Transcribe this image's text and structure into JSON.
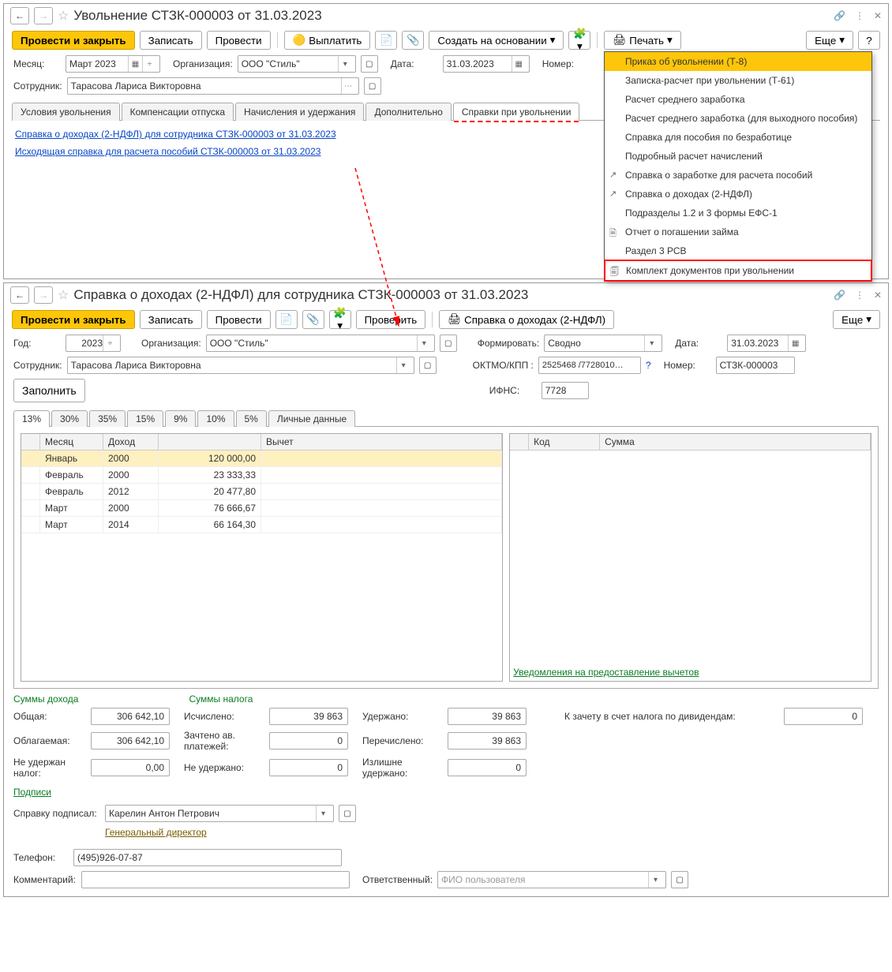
{
  "win1": {
    "title": "Увольнение СТЗК-000003 от 31.03.2023",
    "toolbar": {
      "post_close": "Провести и закрыть",
      "save": "Записать",
      "post": "Провести",
      "pay": "Выплатить",
      "create_based": "Создать на основании",
      "print": "Печать",
      "more": "Еще",
      "help": "?"
    },
    "fields": {
      "month_lbl": "Месяц:",
      "month": "Март 2023",
      "org_lbl": "Организация:",
      "org": "ООО \"Стиль\"",
      "date_lbl": "Дата:",
      "date": "31.03.2023",
      "num_lbl": "Номер:",
      "emp_lbl": "Сотрудник:",
      "emp": "Тарасова Лариса Викторовна"
    },
    "tabs": [
      "Условия увольнения",
      "Компенсации отпуска",
      "Начисления и удержания",
      "Дополнительно",
      "Справки при увольнении"
    ],
    "links": [
      "Справка о доходах (2-НДФЛ) для сотрудника СТЗК-000003 от 31.03.2023",
      "Исходящая справка для расчета пособий СТЗК-000003 от 31.03.2023"
    ],
    "menu": [
      {
        "t": "Приказ об увольнении (Т-8)",
        "hl": true
      },
      {
        "t": "Записка-расчет при увольнении (Т-61)"
      },
      {
        "t": "Расчет среднего заработка"
      },
      {
        "t": "Расчет среднего заработка (для выходного пособия)"
      },
      {
        "t": "Справка для пособия по безработице"
      },
      {
        "t": "Подробный расчет начислений"
      },
      {
        "t": "Справка о заработке для расчета пособий",
        "icon": "↗"
      },
      {
        "t": "Справка о доходах (2-НДФЛ)",
        "icon": "↗"
      },
      {
        "t": "Подразделы 1.2 и 3 формы ЕФС-1"
      },
      {
        "t": "Отчет о погашении займа",
        "icon": "🗎"
      },
      {
        "t": "Раздел 3 РСВ"
      },
      {
        "t": "Комплект документов при увольнении",
        "icon": "🗐",
        "boxed": true
      }
    ]
  },
  "win2": {
    "title": "Справка о доходах (2-НДФЛ) для сотрудника СТЗК-000003 от 31.03.2023",
    "toolbar": {
      "post_close": "Провести и закрыть",
      "save": "Записать",
      "post": "Провести",
      "check": "Проверить",
      "print_ref": "Справка о доходах (2-НДФЛ)",
      "more": "Еще"
    },
    "fields": {
      "year_lbl": "Год:",
      "year": "2023",
      "org_lbl": "Организация:",
      "org": "ООО \"Стиль\"",
      "form_lbl": "Формировать:",
      "form": "Сводно",
      "date_lbl": "Дата:",
      "date": "31.03.2023",
      "emp_lbl": "Сотрудник:",
      "emp": "Тарасова Лариса Викторовна",
      "oktmo_lbl": "ОКТМО/КПП :",
      "oktmo": "2525468  /7728010…",
      "num_lbl": "Номер:",
      "num": "СТЗК-000003",
      "fill": "Заполнить",
      "ifns_lbl": "ИФНС:",
      "ifns": "7728"
    },
    "rate_tabs": [
      "13%",
      "30%",
      "35%",
      "15%",
      "9%",
      "10%",
      "5%",
      "Личные данные"
    ],
    "table1_head": [
      "Месяц",
      "Доход",
      "",
      "Вычет"
    ],
    "table1": [
      [
        "Январь",
        "2000",
        "120 000,00",
        ""
      ],
      [
        "Февраль",
        "2000",
        "23 333,33",
        ""
      ],
      [
        "Февраль",
        "2012",
        "20 477,80",
        ""
      ],
      [
        "Март",
        "2000",
        "76 666,67",
        ""
      ],
      [
        "Март",
        "2014",
        "66 164,30",
        ""
      ]
    ],
    "table2_head": [
      "Код",
      "Сумма"
    ],
    "ded_link": "Уведомления на предоставление вычетов",
    "sums": {
      "h1": "Суммы дохода",
      "h2": "Суммы налога",
      "total_lbl": "Общая:",
      "total": "306 642,10",
      "calc_lbl": "Исчислено:",
      "calc": "39 863",
      "held_lbl": "Удержано:",
      "held": "39 863",
      "credit_lbl": "К зачету в счет налога по дивидендам:",
      "credit": "0",
      "taxable_lbl": "Облагаемая:",
      "taxable": "306 642,10",
      "adv_lbl": "Зачтено ав. платежей:",
      "adv": "0",
      "trans_lbl": "Перечислено:",
      "trans": "39 863",
      "notax_lbl": "Не удержан налог:",
      "notax": "0,00",
      "notheld_lbl": "Не удержано:",
      "notheld": "0",
      "over_lbl": "Излишне удержано:",
      "over": "0"
    },
    "sign": {
      "header": "Подписи",
      "who_lbl": "Справку подписал:",
      "who": "Карелин Антон Петрович",
      "pos": "Генеральный директор",
      "tel_lbl": "Телефон:",
      "tel": "(495)926-07-87",
      "comm_lbl": "Комментарий:",
      "resp_lbl": "Ответственный:",
      "resp": "ФИО пользователя"
    }
  }
}
